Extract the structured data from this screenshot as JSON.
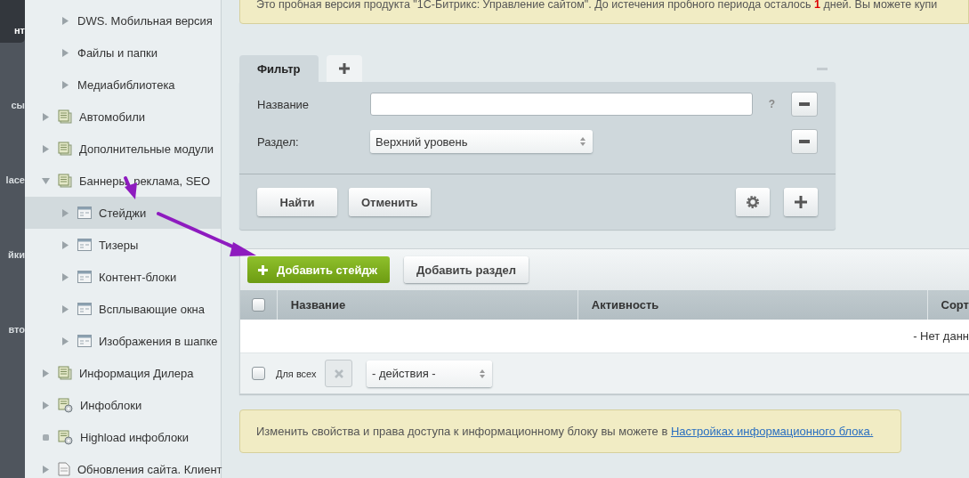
{
  "left_nav": [
    {
      "label": "нт",
      "selected": true
    },
    {
      "label": "сы",
      "selected": false
    },
    {
      "label": "lace",
      "selected": false
    },
    {
      "label": "йки",
      "selected": false
    },
    {
      "label": "вто",
      "selected": false
    }
  ],
  "sidebar": {
    "continued_children": [
      {
        "label": "DWS. Мобильная версия",
        "expandable": true,
        "expanded": false,
        "selected": false
      },
      {
        "label": "Файлы и папки",
        "expandable": true,
        "expanded": false,
        "selected": false
      },
      {
        "label": "Медиабиблиотека",
        "expandable": true,
        "expanded": false,
        "selected": false
      }
    ],
    "items": [
      {
        "label": "Автомобили",
        "kind": "list",
        "expandable": true,
        "expanded": false,
        "selected": false
      },
      {
        "label": "Дополнительные модули",
        "kind": "list",
        "expandable": true,
        "expanded": false,
        "selected": false
      },
      {
        "label": "Баннеры, реклама, SEO",
        "kind": "list",
        "expandable": true,
        "expanded": true,
        "selected": false,
        "children": [
          {
            "label": "Стейджи",
            "kind": "table",
            "expandable": true,
            "expanded": false,
            "selected": true
          },
          {
            "label": "Тизеры",
            "kind": "table",
            "expandable": true,
            "expanded": false,
            "selected": false
          },
          {
            "label": "Контент-блоки",
            "kind": "table",
            "expandable": true,
            "expanded": false,
            "selected": false
          },
          {
            "label": "Всплывающие окна",
            "kind": "table",
            "expandable": true,
            "expanded": false,
            "selected": false
          },
          {
            "label": "Изображения в шапке",
            "kind": "table",
            "expandable": true,
            "expanded": false,
            "selected": false
          }
        ]
      },
      {
        "label": "Информация Дилера",
        "kind": "list",
        "expandable": true,
        "expanded": false,
        "selected": false
      },
      {
        "label": "Инфоблоки",
        "kind": "gear-list",
        "expandable": true,
        "expanded": false,
        "selected": false
      },
      {
        "label": "Highload инфоблоки",
        "kind": "gear-list",
        "expandable": false,
        "selected": false
      },
      {
        "label": "Обновления сайта. Клиент",
        "kind": "page",
        "expandable": true,
        "expanded": false,
        "selected": false
      }
    ]
  },
  "trial_notice": "Это пробная версия продукта \"1С-Битрикс: Управление сайтом\". До истечения пробного периода осталось **1** дней. Вы можете купи",
  "filter": {
    "tabs": [
      {
        "label": "Фильтр",
        "selected": true
      }
    ],
    "name_label": "Название",
    "name_placeholder_hint": "?",
    "section_label": "Раздел:",
    "section_value": "Верхний уровень",
    "buttons": [
      "Найти",
      "Отменить"
    ]
  },
  "list": {
    "add_button": "Добавить стейдж",
    "add_section_button": "Добавить раздел",
    "header_checkbox": {
      "checked": false
    },
    "columns": [
      "Название",
      "Активность",
      "Сорт"
    ],
    "empty_text": "- Нет данн",
    "footer": {
      "checked": false,
      "for_all": "Для всех",
      "action": "- действия -"
    }
  },
  "info": {
    "text": "Изменить свойства и права доступа к информационному блоку вы можете в",
    "link": "Настройках информационного блока."
  }
}
